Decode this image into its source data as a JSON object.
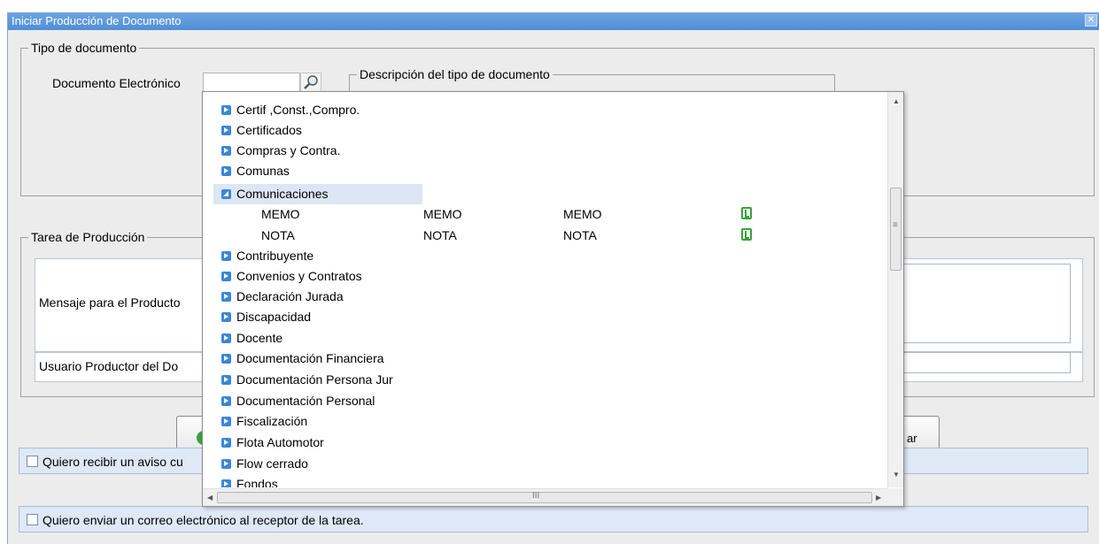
{
  "window": {
    "title": "Iniciar Producción de Documento"
  },
  "tipo_documento": {
    "legend": "Tipo de documento",
    "doc_label": "Documento Electrónico",
    "descripcion_legend": "Descripción del tipo de documento"
  },
  "tarea": {
    "legend": "Tarea de Producción",
    "mensaje_label": "Mensaje para el Producto",
    "usuario_label": "Usuario Productor del Do"
  },
  "buttons": {
    "right_partial": "ar"
  },
  "checkboxes": [
    {
      "label": "Quiero recibir un aviso cu"
    },
    {
      "label": "Quiero enviar un correo electrónico al receptor de la tarea."
    }
  ],
  "dropdown": {
    "nodes": [
      {
        "label": "Certif ,Const.,Compro."
      },
      {
        "label": "Certificados"
      },
      {
        "label": "Compras y Contra."
      },
      {
        "label": "Comunas"
      },
      {
        "label": "Comunicaciones",
        "expanded": true
      },
      {
        "label": "Contribuyente"
      },
      {
        "label": "Convenios y Contratos"
      },
      {
        "label": "Declaración Jurada"
      },
      {
        "label": "Discapacidad"
      },
      {
        "label": "Docente"
      },
      {
        "label": "Documentación Financiera"
      },
      {
        "label": "Documentación Persona Jur"
      },
      {
        "label": "Documentación Personal"
      },
      {
        "label": "Fiscalización"
      },
      {
        "label": "Flota Automotor"
      },
      {
        "label": "Flow cerrado"
      },
      {
        "label": "Fondos"
      }
    ],
    "children": [
      {
        "acronimo": "MEMO",
        "nombre": "MEMO",
        "descripcion": "MEMO"
      },
      {
        "acronimo": "NOTA",
        "nombre": "NOTA",
        "descripcion": "NOTA"
      }
    ],
    "scroll_marker": "III",
    "grip_marker": "≡"
  }
}
